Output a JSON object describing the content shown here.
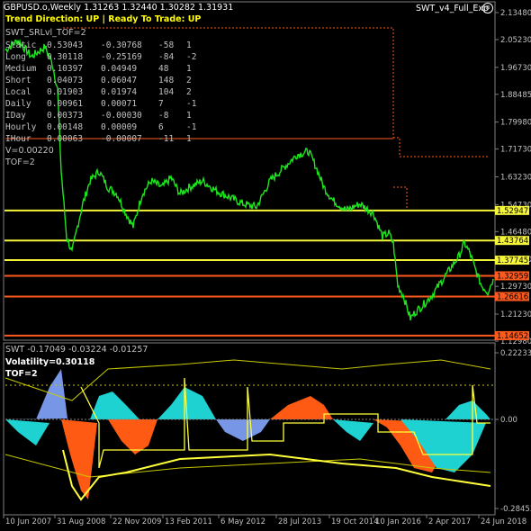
{
  "header": {
    "symbol_line": "GBPUSD.o,Weekly  1.31263 1.32440 1.30282 1.31931",
    "trend_label": "Trend Direction:  UP  |  Ready To Trade:  UP",
    "indicator_name": "SWT_v4_Full_Exp",
    "smiley": "☺"
  },
  "stats": {
    "title": "SWT_SRLvl_TOF=2",
    "rows": [
      {
        "label": "Static",
        "v1": "0.53043",
        "v2": "-0.30768",
        "v3": "-58",
        "v4": "1"
      },
      {
        "label": "Long",
        "v1": "0.30118",
        "v2": "-0.25169",
        "v3": "-84",
        "v4": "-2"
      },
      {
        "label": "Medium",
        "v1": "0.10397",
        "v2": "0.04949",
        "v3": "48",
        "v4": "1"
      },
      {
        "label": "Short",
        "v1": "0.04073",
        "v2": "0.06047",
        "v3": "148",
        "v4": "2"
      },
      {
        "label": "Local",
        "v1": "0.01903",
        "v2": "0.01974",
        "v3": "104",
        "v4": "2"
      },
      {
        "label": "Daily",
        "v1": "0.00961",
        "v2": "0.00071",
        "v3": "7",
        "v4": "-1"
      },
      {
        "label": "IDay",
        "v1": "0.00373",
        "v2": "-0.00030",
        "v3": "-8",
        "v4": "1"
      },
      {
        "label": "Hourly",
        "v1": "0.00148",
        "v2": "0.00009",
        "v3": "6",
        "v4": "-1"
      },
      {
        "label": "IHour",
        "v1": "0.00063",
        "v2": "-0.00007",
        "v3": "-11",
        "v4": "1"
      }
    ],
    "v_line": "V=0.00220",
    "tof_line": "TOF=2"
  },
  "price_axis": {
    "labels": [
      "2.13480",
      "2.05230",
      "1.96730",
      "1.88485",
      "1.79980",
      "1.71730",
      "1.63230",
      "1.54730",
      "1.46480",
      "1.37980",
      "1.29730",
      "1.21230",
      "1.12980"
    ],
    "levels": [
      {
        "value": "1.52947",
        "color": "#f5f53a"
      },
      {
        "value": "1.43764",
        "color": "#f5f53a"
      },
      {
        "value": "1.37745",
        "color": "#f5f53a"
      },
      {
        "value": "1.32959",
        "color": "#ff5a1e"
      },
      {
        "value": "1.26616",
        "color": "#ff5a1e"
      },
      {
        "value": "1.14652",
        "color": "#ff5a1e"
      }
    ]
  },
  "sub_window": {
    "title": "SWT -0.17049 -0.03224 -0.01257",
    "volatility": "Volatility=0.30118",
    "tof": "TOF=2",
    "axis_labels": [
      "0.22233",
      "0.00",
      "-0.28453"
    ]
  },
  "time_axis": [
    "10 Jun 2007",
    "31 Aug 2008",
    "22 Nov 2009",
    "13 Feb 2011",
    "6 May 2012",
    "28 Jul 2013",
    "19 Oct 2014",
    "10 Jan 2016",
    "2 Apr 2017",
    "24 Jun 2018"
  ],
  "colors": {
    "price_line": "#1ee61e",
    "support_line": "#f5f53a",
    "resistance_line": "#ff5a1e",
    "stats_text": "#c0c0c0",
    "header_yellow": "#ffff00",
    "osc_orange": "#ff5a14",
    "osc_cyan": "#1ed2d2",
    "osc_blue": "#7896e6"
  }
}
